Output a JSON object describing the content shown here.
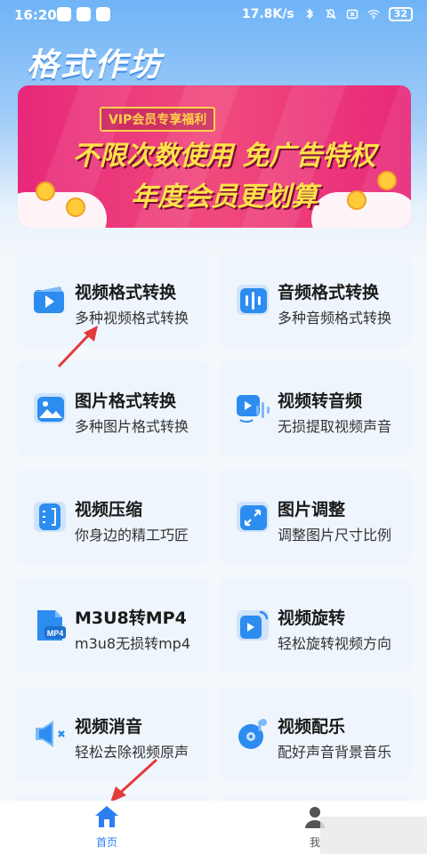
{
  "status": {
    "time": "16:20",
    "speed": "17.8K/s",
    "battery": "32"
  },
  "app": {
    "title": "格式作坊"
  },
  "banner": {
    "tag": "VIP会员专享福利",
    "line1": "不限次数使用 免广告特权",
    "line2": "年度会员更划算"
  },
  "tools": [
    {
      "title": "视频格式转换",
      "subtitle": "多种视频格式转换",
      "icon": "video-play-icon"
    },
    {
      "title": "音频格式转换",
      "subtitle": "多种音频格式转换",
      "icon": "audio-wave-icon"
    },
    {
      "title": "图片格式转换",
      "subtitle": "多种图片格式转换",
      "icon": "image-icon"
    },
    {
      "title": "视频转音频",
      "subtitle": "无损提取视频声音",
      "icon": "video-to-audio-icon"
    },
    {
      "title": "视频压缩",
      "subtitle": "你身边的精工巧匠",
      "icon": "compress-icon"
    },
    {
      "title": "图片调整",
      "subtitle": "调整图片尺寸比例",
      "icon": "resize-icon"
    },
    {
      "title": "M3U8转MP4",
      "subtitle": "m3u8无损转mp4",
      "icon": "mp4-file-icon"
    },
    {
      "title": "视频旋转",
      "subtitle": "轻松旋转视频方向",
      "icon": "rotate-video-icon"
    },
    {
      "title": "视频消音",
      "subtitle": "轻松去除视频原声",
      "icon": "mute-icon"
    },
    {
      "title": "视频配乐",
      "subtitle": "配好声音背景音乐",
      "icon": "music-disc-icon"
    }
  ],
  "tabs": {
    "home": "首页",
    "me": "我"
  },
  "colors": {
    "accent": "#2d7ff0",
    "card": "#eef5fd",
    "banner": "#e8287a",
    "annotation": "#e23b3b"
  }
}
